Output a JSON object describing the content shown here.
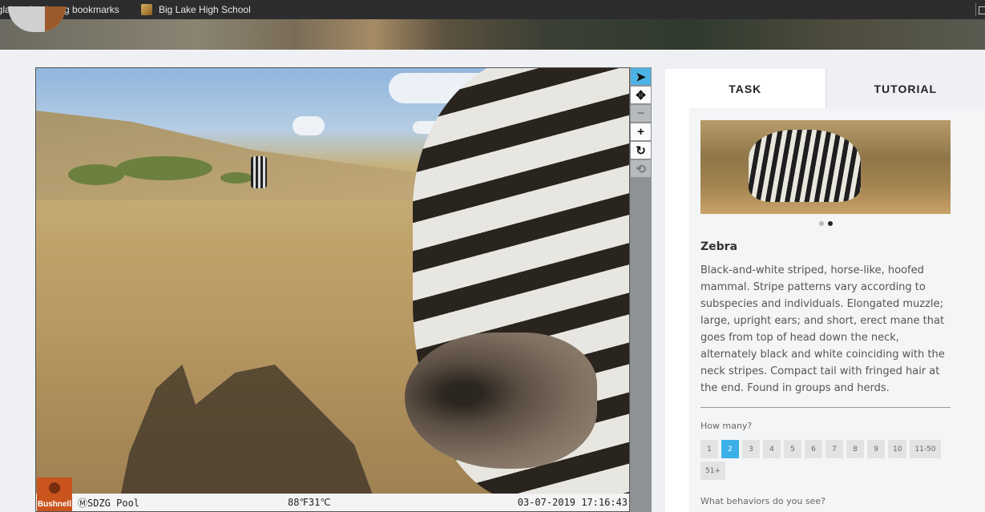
{
  "bookmarks": {
    "item1": "iglakeschools.org bookmarks",
    "item2": "Big Lake High School"
  },
  "viewer": {
    "camera_name": "ⓂSDZG Pool",
    "temperature": "88℉31℃",
    "timestamp": "03-07-2019 17:16:43",
    "brand": "Bushnell"
  },
  "tools": [
    {
      "name": "pointer-icon",
      "glyph": "➤"
    },
    {
      "name": "move-icon",
      "glyph": "✥"
    },
    {
      "name": "zoom-out-icon",
      "glyph": "−"
    },
    {
      "name": "zoom-in-icon",
      "glyph": "+"
    },
    {
      "name": "rotate-icon",
      "glyph": "↻"
    },
    {
      "name": "reset-icon",
      "glyph": "⟲"
    }
  ],
  "panel": {
    "tab_task": "TASK",
    "tab_tutorial": "TUTORIAL",
    "animal_name": "Zebra",
    "animal_desc": "Black-and-white striped, horse-like, hoofed mammal. Stripe patterns vary according to subspecies and individuals. Elongated muzzle; large, upright ears; and short, erect mane that goes from top of head down the neck, alternately black and white coinciding with the neck stripes. Compact tail with fringed hair at the end. Found in groups and herds.",
    "how_many_label": "How many?",
    "counts": [
      "1",
      "2",
      "3",
      "4",
      "5",
      "6",
      "7",
      "8",
      "9",
      "10",
      "11-50",
      "51+"
    ],
    "selected_count": "2",
    "behaviors_label": "What behaviors do you see?"
  },
  "colors": {
    "accent": "#3bb0e6",
    "bookmarks_bg": "#2d2d2f"
  }
}
